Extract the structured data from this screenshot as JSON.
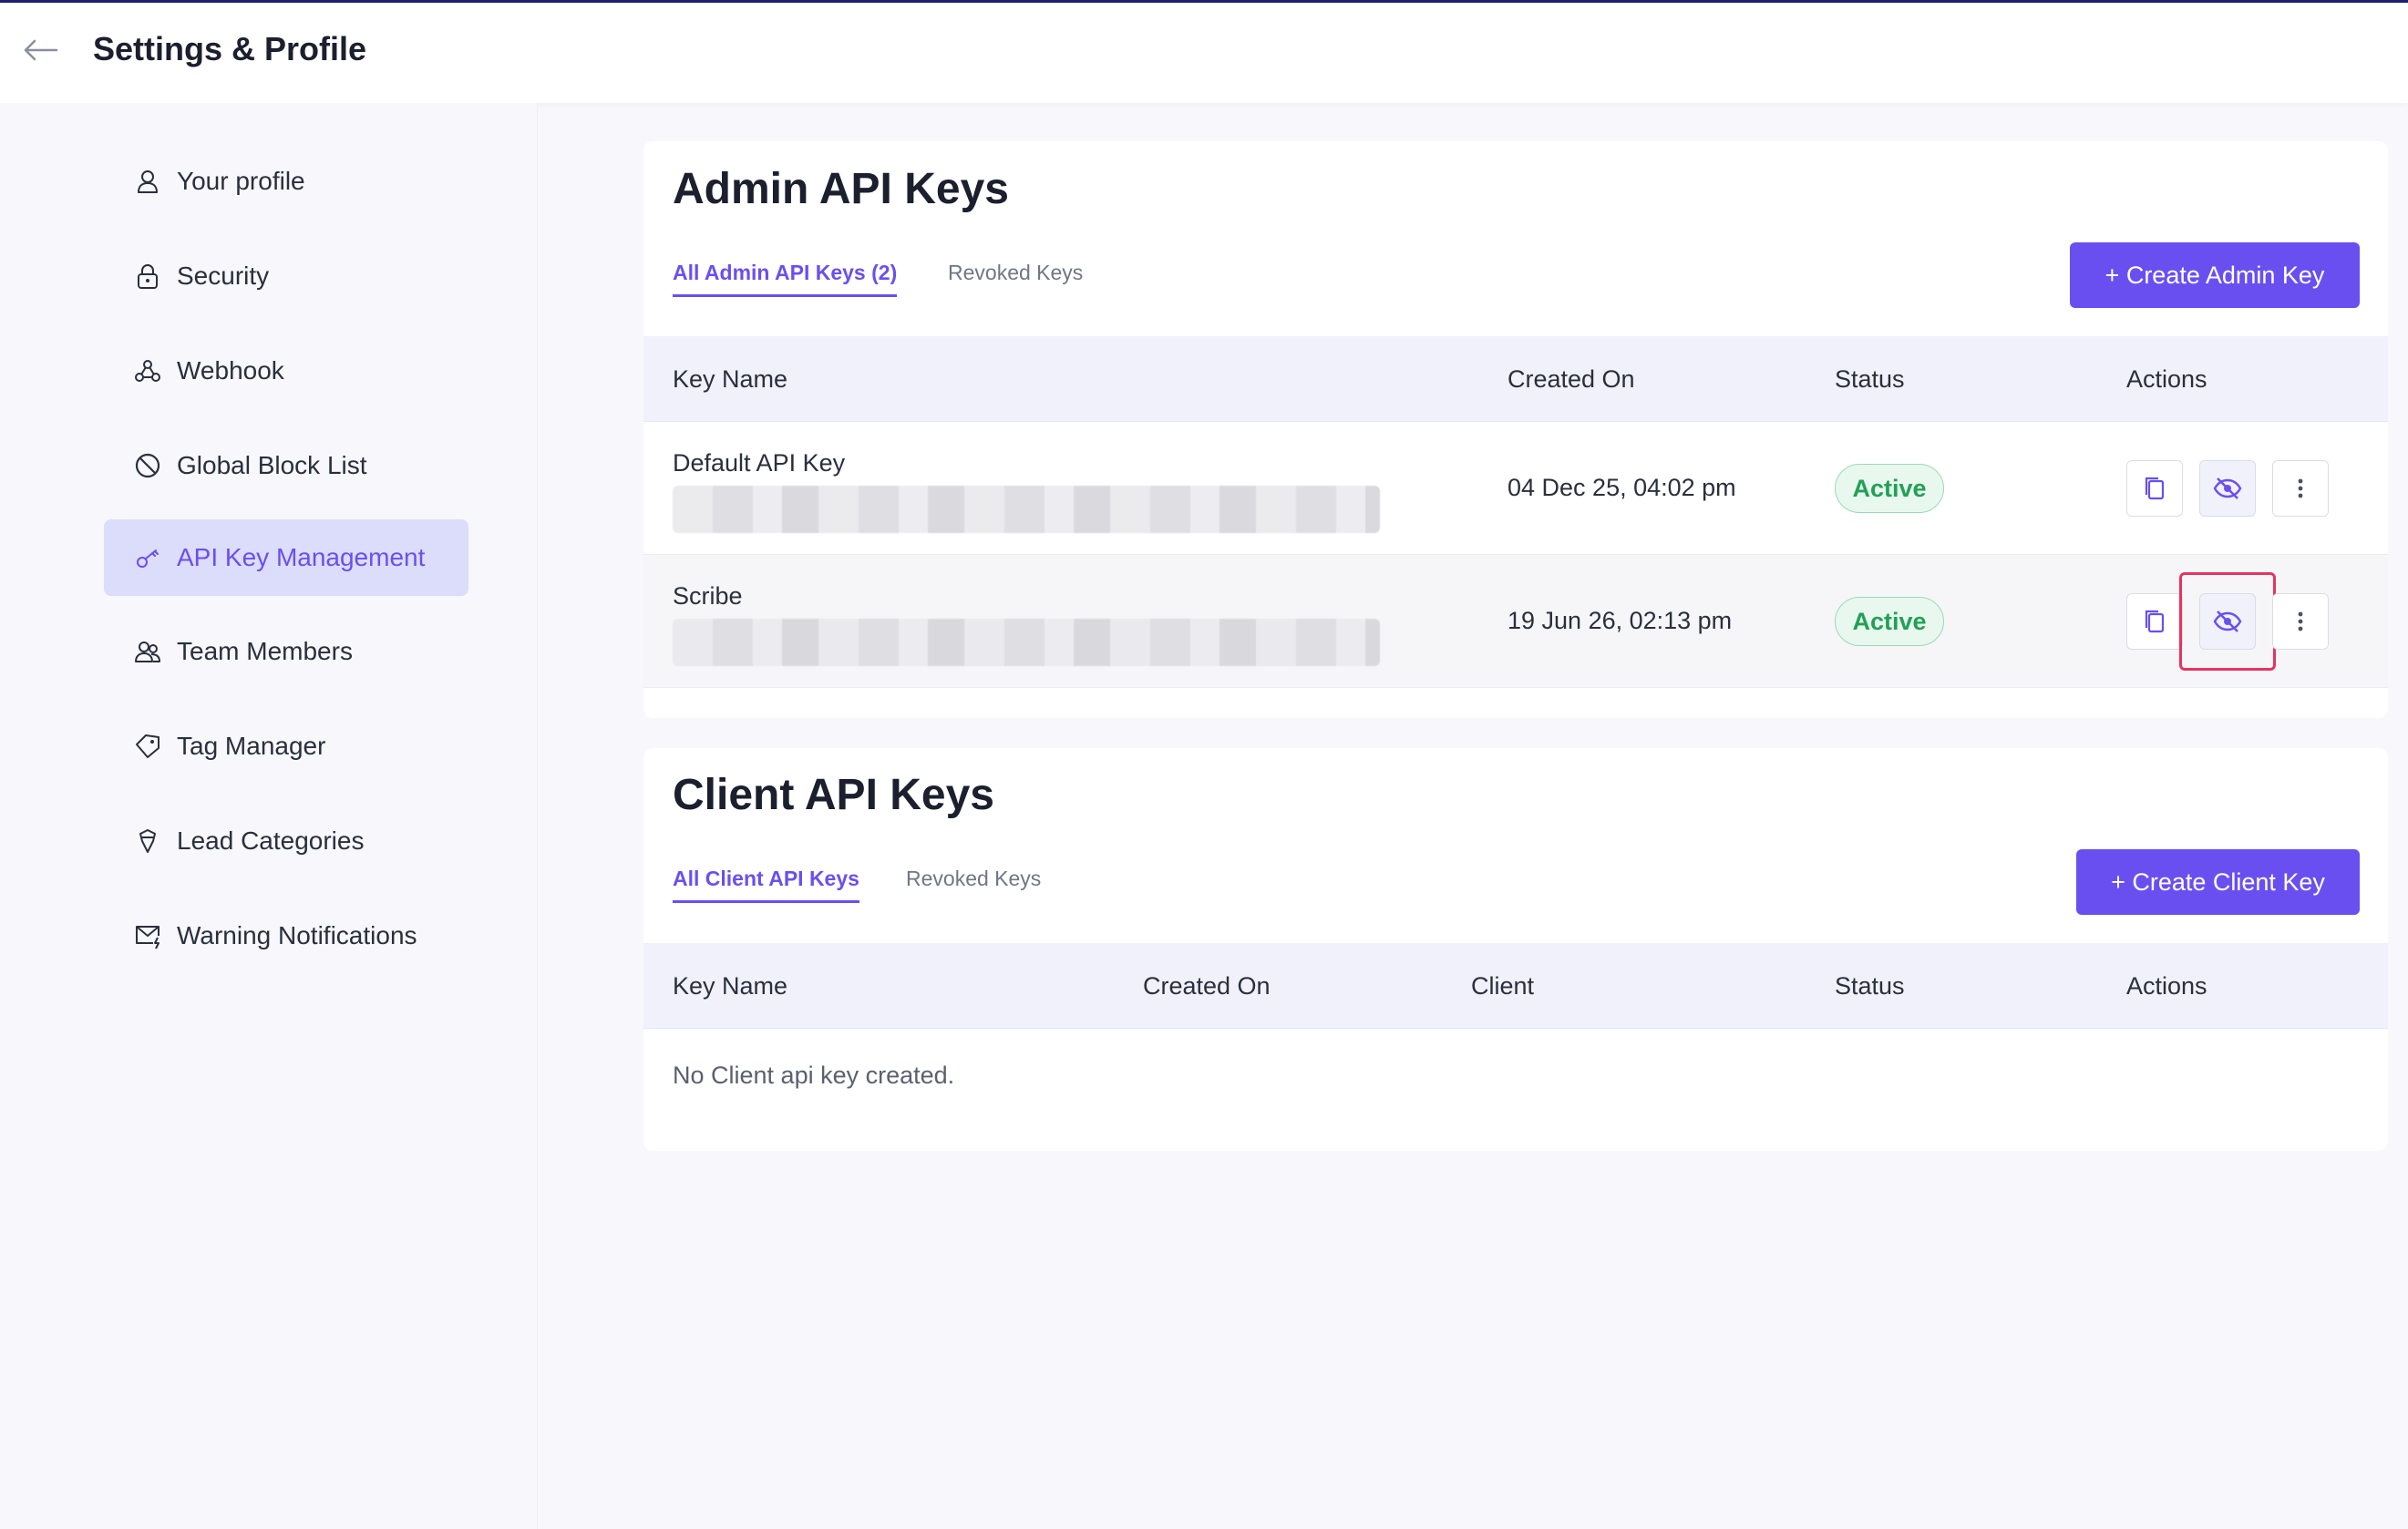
{
  "header": {
    "title": "Settings & Profile",
    "back_icon": "arrow-left-icon"
  },
  "sidebar": {
    "items": [
      {
        "label": "Your profile",
        "icon": "user-icon",
        "active": false
      },
      {
        "label": "Security",
        "icon": "lock-icon",
        "active": false
      },
      {
        "label": "Webhook",
        "icon": "webhook-icon",
        "active": false
      },
      {
        "label": "Global Block List",
        "icon": "block-icon",
        "active": false
      },
      {
        "label": "API Key Management",
        "icon": "key-icon",
        "active": true
      },
      {
        "label": "Team Members",
        "icon": "team-icon",
        "active": false
      },
      {
        "label": "Tag Manager",
        "icon": "tag-icon",
        "active": false
      },
      {
        "label": "Lead Categories",
        "icon": "lead-categories-icon",
        "active": false
      },
      {
        "label": "Warning Notifications",
        "icon": "mail-warning-icon",
        "active": false
      }
    ]
  },
  "admin": {
    "title": "Admin API Keys",
    "tabs": {
      "all": "All Admin API Keys (2)",
      "revoked": "Revoked Keys"
    },
    "create_button": "+ Create Admin Key",
    "columns": {
      "name": "Key Name",
      "created": "Created On",
      "status": "Status",
      "actions": "Actions"
    },
    "rows": [
      {
        "name": "Default API Key",
        "created": "04 Dec 25, 04:02 pm",
        "status": "Active"
      },
      {
        "name": "Scribe",
        "created": "19 Jun 26, 02:13 pm",
        "status": "Active"
      }
    ]
  },
  "client": {
    "title": "Client API Keys",
    "tabs": {
      "all": "All Client API Keys",
      "revoked": "Revoked Keys"
    },
    "create_button": "+ Create Client Key",
    "columns": {
      "name": "Key Name",
      "created": "Created On",
      "client": "Client",
      "status": "Status",
      "actions": "Actions"
    },
    "empty": "No Client api key created."
  },
  "colors": {
    "accent": "#6a4ff0",
    "active_green": "#21a155",
    "highlight": "#e5345f"
  }
}
